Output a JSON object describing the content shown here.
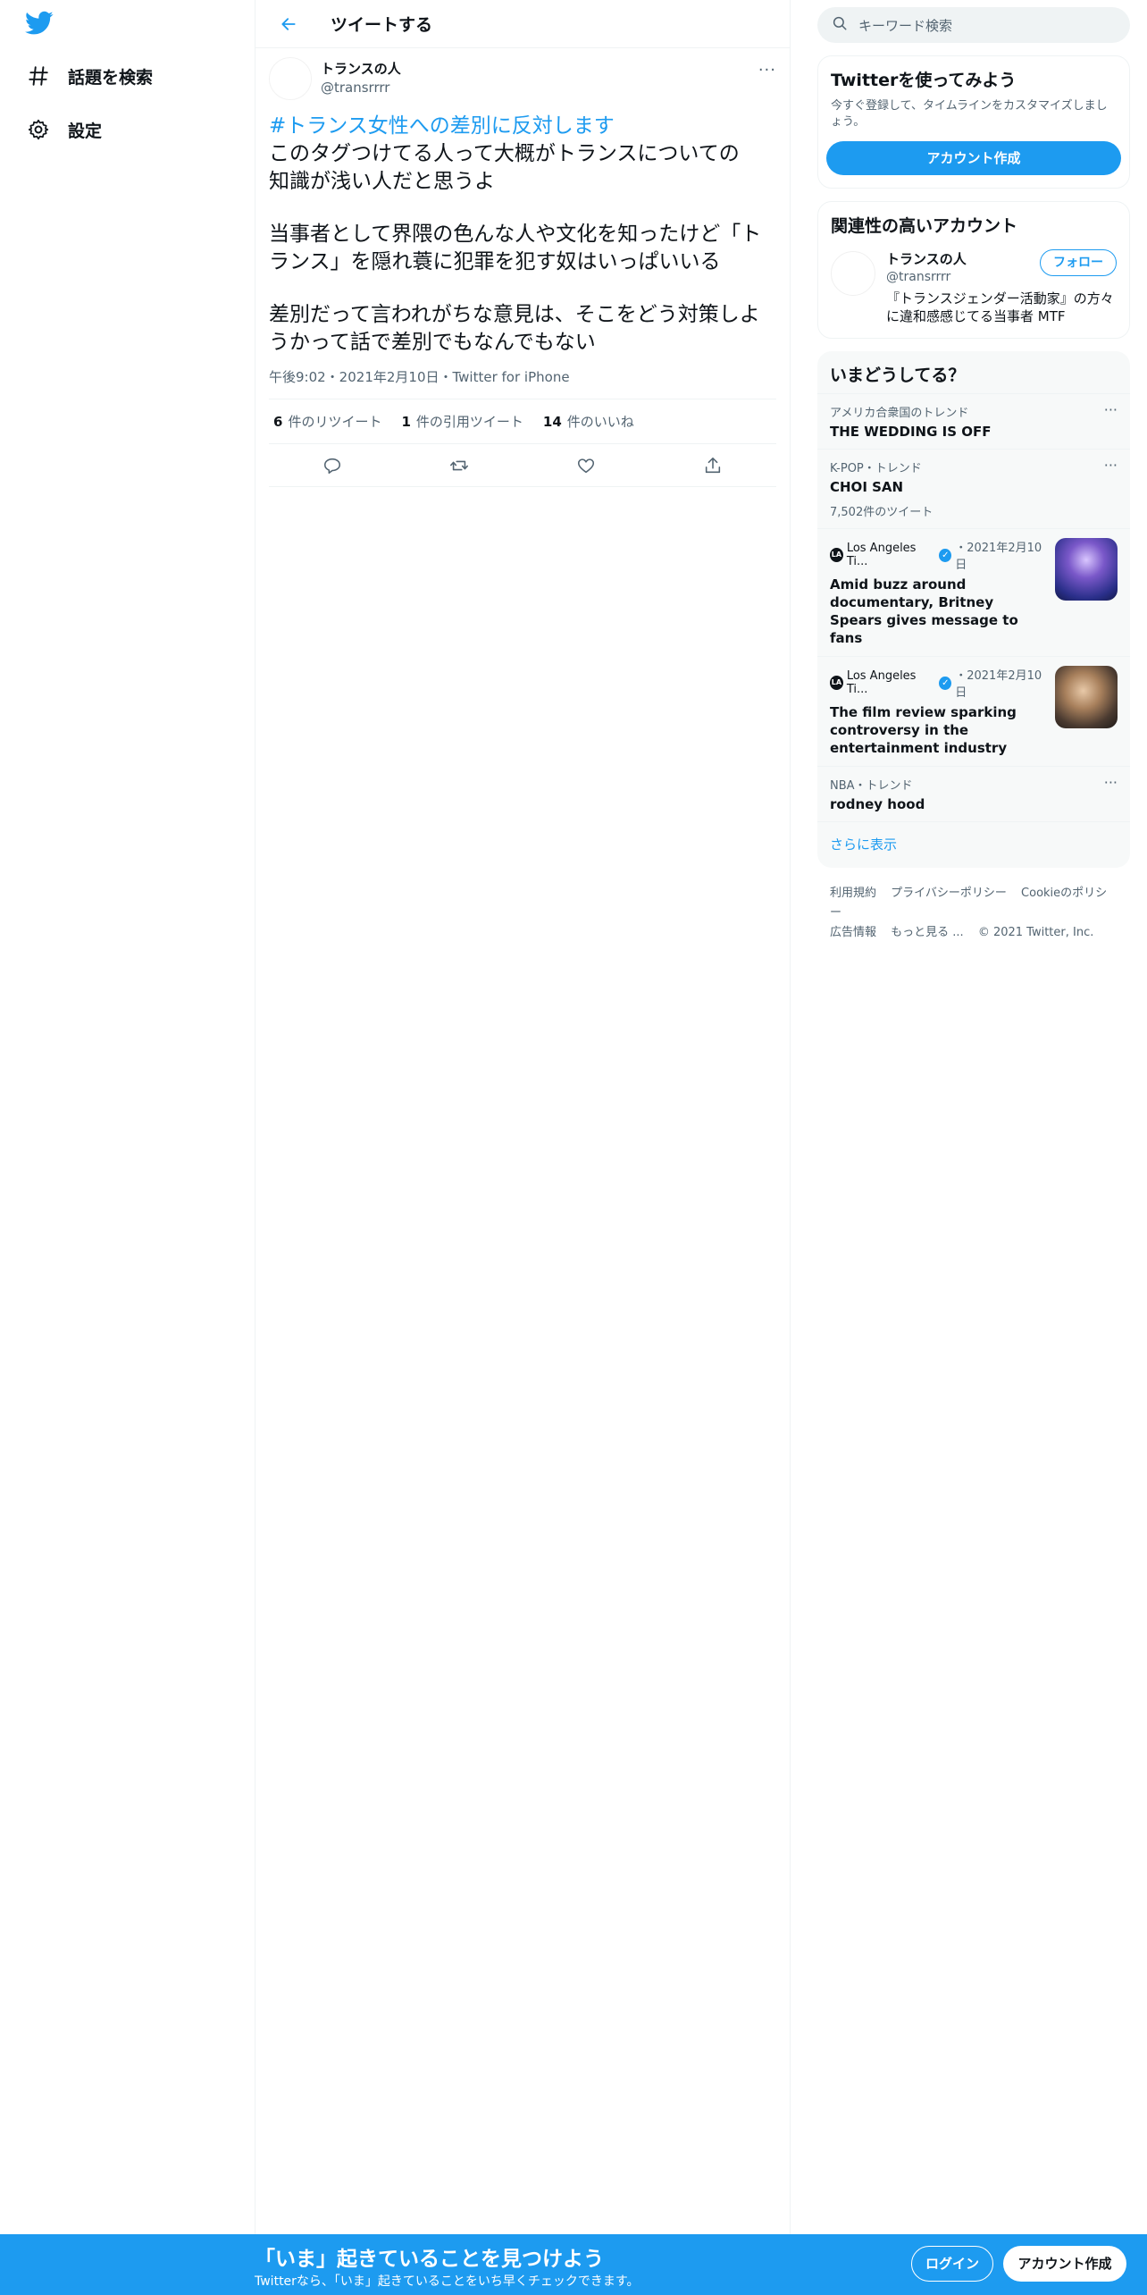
{
  "colors": {
    "accent": "#1d9bf0",
    "text": "#0f1419",
    "muted": "#536471"
  },
  "nav": {
    "logo_icon": "twitter-bird-icon",
    "items": [
      {
        "icon": "hashtag-icon",
        "label": "話題を検索"
      },
      {
        "icon": "gear-icon",
        "label": "設定"
      }
    ]
  },
  "header": {
    "title": "ツイートする",
    "back_icon": "arrow-left-icon"
  },
  "tweet": {
    "author_name": "トランスの人",
    "author_handle": "@transrrrr",
    "hashtag": "#トランス女性への差別に反対します",
    "lines": [
      "このタグつけてる人って大概がトランスについての",
      "知識が浅い人だと思うよ",
      "当事者として界隈の色んな人や文化を知ったけど「ト",
      "ランス」を隠れ蓑に犯罪を犯す奴はいっぱいいる",
      "差別だって言われがちな意見は、そこをどう対策しよ",
      "うかって話で差別でもなんでもない"
    ],
    "meta": "午後9:02・2021年2月10日・Twitter for iPhone",
    "stats": {
      "retweets_num": "6",
      "retweets_label": "件のリツイート",
      "quotes_num": "1",
      "quotes_label": "件の引用ツイート",
      "likes_num": "14",
      "likes_label": "件のいいね"
    }
  },
  "sidebar": {
    "search_placeholder": "キーワード検索",
    "signup": {
      "title": "Twitterを使ってみよう",
      "subtitle": "今すぐ登録して、タイムラインをカスタマイズしましょう。",
      "button": "アカウント作成"
    },
    "related": {
      "title": "関連性の高いアカウント",
      "name": "トランスの人",
      "handle": "@transrrrr",
      "bio": "『トランスジェンダー活動家』の方々に違和感感じてる当事者 MTF",
      "follow": "フォロー"
    },
    "trends": {
      "title": "いまどうしてる？",
      "items": [
        {
          "context": "アメリカ合衆国のトレンド",
          "name": "THE WEDDING IS OFF"
        },
        {
          "context": "K-POP・トレンド",
          "name": "CHOI SAN",
          "count": "7,502件のツイート"
        }
      ],
      "news": [
        {
          "source": "Los Angeles Ti...",
          "date": "・2021年2月10日",
          "title": "Amid buzz around documentary, Britney Spears gives message to fans"
        },
        {
          "source": "Los Angeles Ti...",
          "date": "・2021年2月10日",
          "title": "The film review sparking controversy in the entertainment industry"
        }
      ],
      "last": {
        "context": "NBA・トレンド",
        "name": "rodney hood"
      },
      "show_more": "さらに表示"
    },
    "footer": {
      "links": [
        "利用規約",
        "プライバシーポリシー",
        "Cookieのポリシー",
        "広告情報",
        "もっと見る ..."
      ],
      "copyright": "© 2021 Twitter, Inc."
    }
  },
  "bottom_bar": {
    "title": "「いま」起きていることを見つけよう",
    "subtitle": "Twitterなら、「いま」起きていることをいち早くチェックできます。",
    "login": "ログイン",
    "signup": "アカウント作成"
  }
}
